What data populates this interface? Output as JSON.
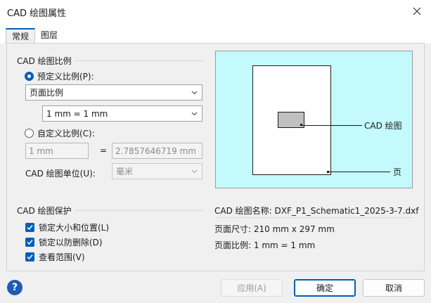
{
  "window": {
    "title": "CAD 绘图属性"
  },
  "tabs": [
    {
      "label": "常规"
    },
    {
      "label": "图层"
    }
  ],
  "scale": {
    "section_title": "CAD 绘图比例",
    "predefined_label": "预定义比例(P):",
    "predefined_type": "页面比例",
    "predefined_value": "1 mm = 1 mm",
    "custom_label": "自定义比例(C):",
    "custom_left": "1 mm",
    "equals": "=",
    "custom_right": "2.7857646719 mm",
    "unit_label": "CAD 绘图单位(U):",
    "unit_value": "毫米"
  },
  "preview": {
    "cad_label": "CAD 绘图",
    "page_label": "页"
  },
  "protection": {
    "section_title": "CAD 绘图保护",
    "items": [
      {
        "label": "锁定大小和位置(L)",
        "checked": true
      },
      {
        "label": "锁定以防删除(D)",
        "checked": true
      },
      {
        "label": "查看范围(V)",
        "checked": true
      }
    ]
  },
  "info": {
    "name_label": "CAD 绘图名称:",
    "name_value": "DXF_P1_Schematic1_2025-3-7.dxf",
    "size_label": "页面尺寸:",
    "size_value": "210 mm x 297 mm",
    "scale_label": "页面比例:",
    "scale_value": "1 mm = 1 mm"
  },
  "footer": {
    "help": "?",
    "apply": "应用(A)",
    "ok": "确定",
    "cancel": "取消"
  },
  "colors": {
    "accent": "#005fb8",
    "preview_bg": "#c4fafc",
    "cad_fill": "#c0c0c0"
  }
}
